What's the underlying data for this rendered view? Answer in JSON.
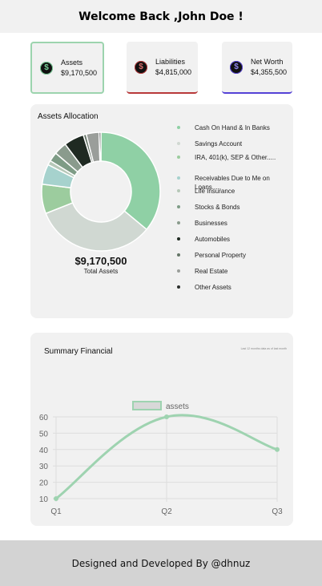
{
  "header": {
    "title": "Welcome Back ,John Doe !"
  },
  "cards": {
    "assets": {
      "label": "Assets",
      "value": "$9,170,500",
      "icon": "dollar-icon",
      "color": "#7ad39a"
    },
    "liabilities": {
      "label": "Liabilities",
      "value": "$4,815,000",
      "icon": "dollar-icon",
      "color": "#b8393a"
    },
    "net_worth": {
      "label": "Net Worth",
      "value": "$4,355,500",
      "icon": "dollar-icon",
      "color": "#5542d6"
    }
  },
  "allocation": {
    "title": "Assets Allocation",
    "total_value": "$9,170,500",
    "total_label": "Total Assets",
    "legend": [
      {
        "label": "Cash On Hand & In Banks",
        "color": "#8fd0a5"
      },
      {
        "label": "Savings Account",
        "color": "#d0d8d2"
      },
      {
        "label": "IRA, 401(k), SEP & Other.....",
        "color": "#9ccc9e"
      },
      {
        "label": "Receivables Due to Me on Loans.....",
        "color": "#a6d2cd"
      },
      {
        "label": "Life Insurance",
        "color": "#b6c8b8"
      },
      {
        "label": "Stocks & Bonds",
        "color": "#7e9c86"
      },
      {
        "label": "Businesses",
        "color": "#8a9b8d"
      },
      {
        "label": "Automobiles",
        "color": "#1f2a22"
      },
      {
        "label": "Personal Property",
        "color": "#657567"
      },
      {
        "label": "Real Estate",
        "color": "#9a9e9a"
      },
      {
        "label": "Other Assets",
        "color": "#2b2f2c"
      }
    ]
  },
  "chart_data": [
    {
      "type": "pie",
      "categories": [
        "Cash On Hand & In Banks",
        "Savings Account",
        "IRA, 401(k), SEP & Other.....",
        "Receivables Due to Me on Loans.....",
        "Life Insurance",
        "Stocks & Bonds",
        "Businesses",
        "Automobiles",
        "Personal Property",
        "Real Estate",
        "Other Assets"
      ],
      "values": [
        36,
        33,
        8,
        5.5,
        1.2,
        2.5,
        3.5,
        5.5,
        0.8,
        3.5,
        0.5
      ],
      "title": "Assets Allocation"
    },
    {
      "type": "line",
      "title": "Summary Financial",
      "note": "Last 12 months data as of last month",
      "categories": [
        "Q1",
        "Q2",
        "Q3"
      ],
      "series": [
        {
          "name": "assets",
          "values": [
            10,
            60,
            40
          ],
          "color": "#9ed3b0"
        }
      ],
      "ylim": [
        10,
        60
      ],
      "yticks": [
        10,
        20,
        30,
        40,
        50,
        60
      ],
      "grid": true,
      "legend": "top"
    }
  ],
  "footer": {
    "text": "Designed and Developed By @dhnuz"
  }
}
